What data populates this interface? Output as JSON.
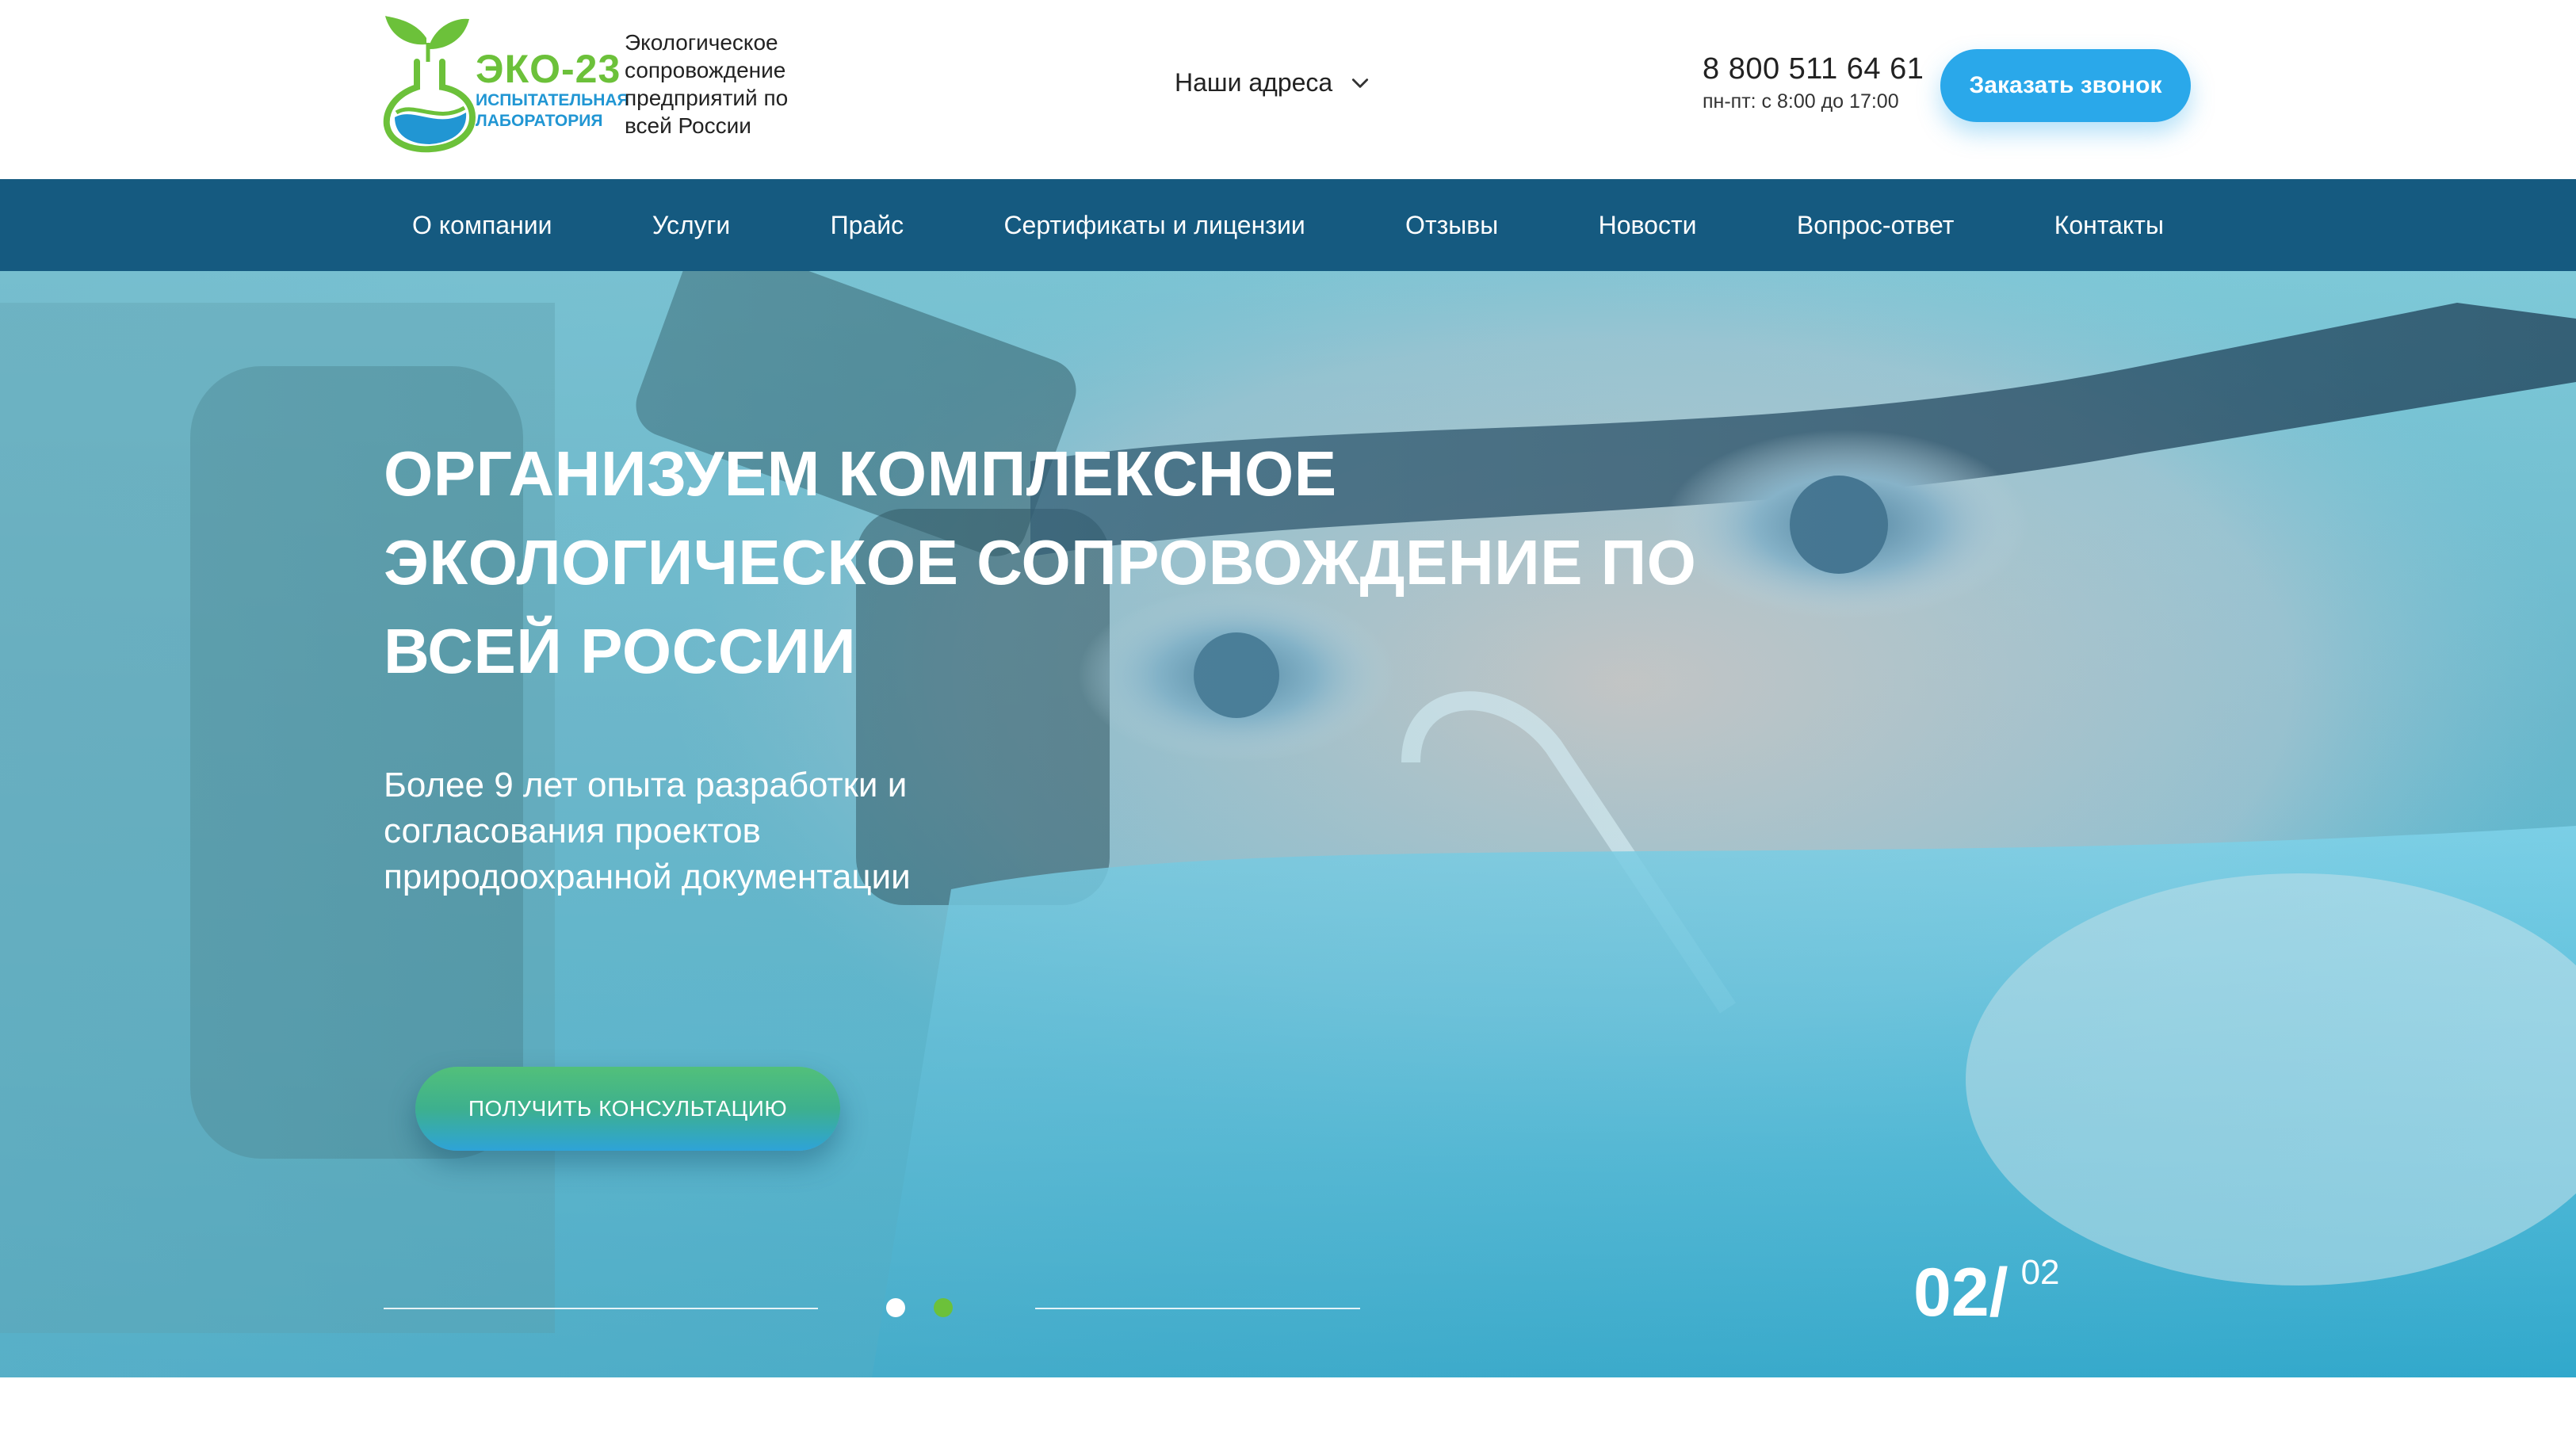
{
  "header": {
    "logo_title": "ЭКО-23",
    "logo_subtitle": "ИСПЫТАТЕЛЬНАЯ ЛАБОРАТОРИЯ",
    "tagline": "Экологическое сопровождение предприятий по всей России",
    "addresses_label": "Наши адреса",
    "phone": "8 800 511 64 61",
    "hours": "пн-пт: с 8:00 до 17:00",
    "call_button": "Заказать звонок"
  },
  "nav": {
    "items": [
      {
        "label": "О компании"
      },
      {
        "label": "Услуги"
      },
      {
        "label": "Прайс"
      },
      {
        "label": "Сертификаты и лицензии"
      },
      {
        "label": "Отзывы"
      },
      {
        "label": "Новости"
      },
      {
        "label": "Вопрос-ответ"
      },
      {
        "label": "Контакты"
      }
    ]
  },
  "hero": {
    "title": "ОРГАНИЗУЕМ КОМПЛЕКСНОЕ ЭКОЛОГИЧЕСКОЕ СОПРОВОЖДЕНИЕ ПО ВСЕЙ РОССИИ",
    "subtitle": "Более 9 лет опыта разработки и согласования проектов природоохранной документации",
    "cta": "ПОЛУЧИТЬ КОНСУЛЬТАЦИЮ",
    "slide_current": "02/",
    "slide_total": "02",
    "active_slide": 2
  },
  "colors": {
    "nav_bg": "#155a80",
    "accent_blue": "#2aa8ea",
    "accent_green": "#6cc13a"
  }
}
